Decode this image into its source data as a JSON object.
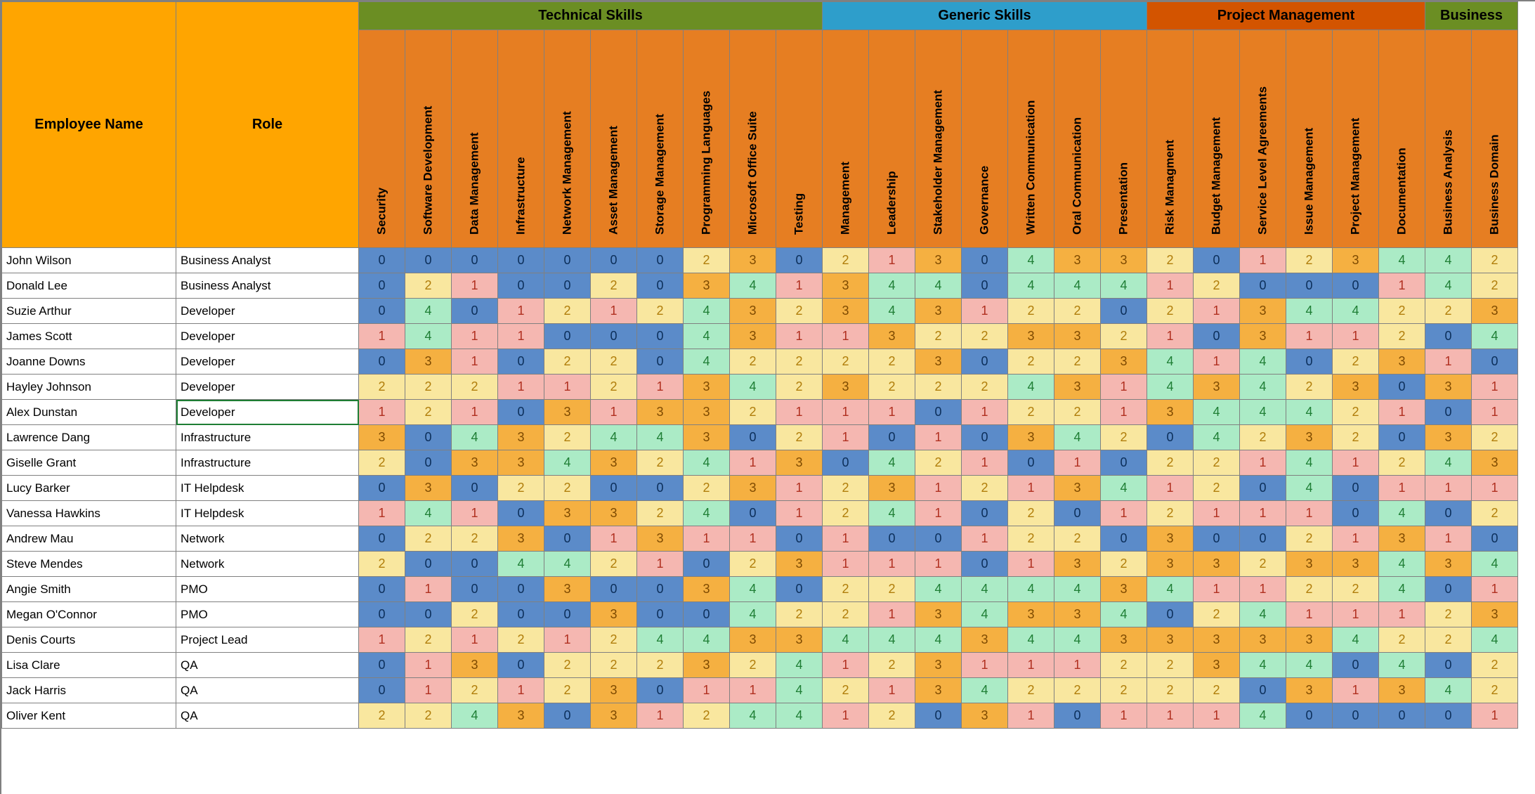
{
  "headers": {
    "name": "Employee Name",
    "role": "Role",
    "groups": [
      {
        "label": "Technical Skills",
        "span": 10,
        "cls": "grp-tech"
      },
      {
        "label": "Generic Skills",
        "span": 7,
        "cls": "grp-gen"
      },
      {
        "label": "Project Management",
        "span": 6,
        "cls": "grp-pm"
      },
      {
        "label": "Business",
        "span": 2,
        "cls": "grp-bus"
      }
    ],
    "skills": [
      "Security",
      "Software Development",
      "Data Management",
      "Infrastructure",
      "Network Management",
      "Asset Management",
      "Storage Management",
      "Programming Languages",
      "Microsoft Office Suite",
      "Testing",
      "Management",
      "Leadership",
      "Stakeholder Management",
      "Governance",
      "Written Communication",
      "Oral Communication",
      "Presentation",
      "Risk Managment",
      "Budget Management",
      "Service Level Agreements",
      "Issue Management",
      "Project Management",
      "Documentation",
      "Business Analysis",
      "Business Domain"
    ]
  },
  "rows": [
    {
      "name": "John Wilson",
      "role": "Business Analyst",
      "vals": [
        0,
        0,
        0,
        0,
        0,
        0,
        0,
        2,
        3,
        0,
        2,
        1,
        3,
        0,
        4,
        3,
        3,
        2,
        0,
        1,
        2,
        3,
        4,
        4,
        2
      ]
    },
    {
      "name": "Donald Lee",
      "role": "Business Analyst",
      "vals": [
        0,
        2,
        1,
        0,
        0,
        2,
        0,
        3,
        4,
        1,
        3,
        4,
        4,
        0,
        4,
        4,
        4,
        1,
        2,
        0,
        0,
        0,
        1,
        4,
        2
      ]
    },
    {
      "name": "Suzie Arthur",
      "role": "Developer",
      "vals": [
        0,
        4,
        0,
        1,
        2,
        1,
        2,
        4,
        3,
        2,
        3,
        4,
        3,
        1,
        2,
        2,
        0,
        2,
        1,
        3,
        4,
        4,
        2,
        2,
        3
      ]
    },
    {
      "name": "James Scott",
      "role": "Developer",
      "vals": [
        1,
        4,
        1,
        1,
        0,
        0,
        0,
        4,
        3,
        1,
        1,
        3,
        2,
        2,
        3,
        3,
        2,
        1,
        0,
        3,
        1,
        1,
        2,
        0,
        4
      ]
    },
    {
      "name": "Joanne Downs",
      "role": "Developer",
      "vals": [
        0,
        3,
        1,
        0,
        2,
        2,
        0,
        4,
        2,
        2,
        2,
        2,
        3,
        0,
        2,
        2,
        3,
        4,
        1,
        4,
        0,
        2,
        3,
        1,
        0
      ]
    },
    {
      "name": "Hayley Johnson",
      "role": "Developer",
      "vals": [
        2,
        2,
        2,
        1,
        1,
        2,
        1,
        3,
        4,
        2,
        3,
        2,
        2,
        2,
        4,
        3,
        1,
        4,
        3,
        4,
        2,
        3,
        0,
        3,
        1
      ]
    },
    {
      "name": "Alex Dunstan",
      "role": "Developer",
      "vals": [
        1,
        2,
        1,
        0,
        3,
        1,
        3,
        3,
        2,
        1,
        1,
        1,
        0,
        1,
        2,
        2,
        1,
        3,
        4,
        4,
        4,
        2,
        1,
        0,
        1
      ]
    },
    {
      "name": "Lawrence Dang",
      "role": "Infrastructure",
      "vals": [
        3,
        0,
        4,
        3,
        2,
        4,
        4,
        3,
        0,
        2,
        1,
        0,
        1,
        0,
        3,
        4,
        2,
        0,
        4,
        2,
        3,
        2,
        0,
        3,
        2
      ]
    },
    {
      "name": "Giselle Grant",
      "role": "Infrastructure",
      "vals": [
        2,
        0,
        3,
        3,
        4,
        3,
        2,
        4,
        1,
        3,
        0,
        4,
        2,
        1,
        0,
        1,
        0,
        2,
        2,
        1,
        4,
        1,
        2,
        4,
        3
      ]
    },
    {
      "name": "Lucy Barker",
      "role": "IT Helpdesk",
      "vals": [
        0,
        3,
        0,
        2,
        2,
        0,
        0,
        2,
        3,
        1,
        2,
        3,
        1,
        2,
        1,
        3,
        4,
        1,
        2,
        0,
        4,
        0,
        1,
        1,
        1
      ]
    },
    {
      "name": "Vanessa Hawkins",
      "role": "IT Helpdesk",
      "vals": [
        1,
        4,
        1,
        0,
        3,
        3,
        2,
        4,
        0,
        1,
        2,
        4,
        1,
        0,
        2,
        0,
        1,
        2,
        1,
        1,
        1,
        0,
        4,
        0,
        2
      ]
    },
    {
      "name": "Andrew Mau",
      "role": "Network",
      "vals": [
        0,
        2,
        2,
        3,
        0,
        1,
        3,
        1,
        1,
        0,
        1,
        0,
        0,
        1,
        2,
        2,
        0,
        3,
        0,
        0,
        2,
        1,
        3,
        1,
        0
      ]
    },
    {
      "name": "Steve Mendes",
      "role": "Network",
      "vals": [
        2,
        0,
        0,
        4,
        4,
        2,
        1,
        0,
        2,
        3,
        1,
        1,
        1,
        0,
        1,
        3,
        2,
        3,
        3,
        2,
        3,
        3,
        4,
        3,
        4
      ]
    },
    {
      "name": "Angie Smith",
      "role": "PMO",
      "vals": [
        0,
        1,
        0,
        0,
        3,
        0,
        0,
        3,
        4,
        0,
        2,
        2,
        4,
        4,
        4,
        4,
        3,
        4,
        1,
        1,
        2,
        2,
        4,
        0,
        1
      ]
    },
    {
      "name": "Megan O'Connor",
      "role": "PMO",
      "vals": [
        0,
        0,
        2,
        0,
        0,
        3,
        0,
        0,
        4,
        2,
        2,
        1,
        3,
        4,
        3,
        3,
        4,
        0,
        2,
        4,
        1,
        1,
        1,
        2,
        3
      ]
    },
    {
      "name": "Denis Courts",
      "role": "Project Lead",
      "vals": [
        1,
        2,
        1,
        2,
        1,
        2,
        4,
        4,
        3,
        3,
        4,
        4,
        4,
        3,
        4,
        4,
        3,
        3,
        3,
        3,
        3,
        4,
        2,
        2,
        4
      ]
    },
    {
      "name": "Lisa Clare",
      "role": "QA",
      "vals": [
        0,
        1,
        3,
        0,
        2,
        2,
        2,
        3,
        2,
        4,
        1,
        2,
        3,
        1,
        1,
        1,
        2,
        2,
        3,
        4,
        4,
        0,
        4,
        0,
        2
      ]
    },
    {
      "name": "Jack Harris",
      "role": "QA",
      "vals": [
        0,
        1,
        2,
        1,
        2,
        3,
        0,
        1,
        1,
        4,
        2,
        1,
        3,
        4,
        2,
        2,
        2,
        2,
        2,
        0,
        3,
        1,
        3,
        4,
        2
      ]
    },
    {
      "name": "Oliver Kent",
      "role": "QA",
      "vals": [
        2,
        2,
        4,
        3,
        0,
        3,
        1,
        2,
        4,
        4,
        1,
        2,
        0,
        3,
        1,
        0,
        1,
        1,
        1,
        4,
        0,
        0,
        0,
        0,
        1
      ]
    }
  ],
  "selected_row": 6,
  "colors": {
    "0": "#5b8bc9",
    "1": "#f5b7b1",
    "2": "#f9e79f",
    "3": "#f5b041",
    "4": "#abebc6"
  }
}
